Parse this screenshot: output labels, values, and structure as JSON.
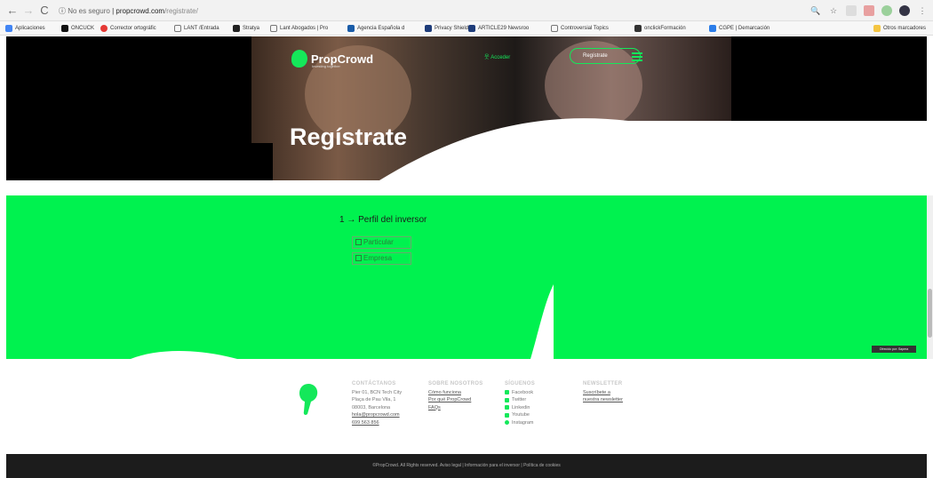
{
  "browser": {
    "secure_label": "No es seguro",
    "domain": "propcrowd.com",
    "path": "/registrate/",
    "bookmarks": [
      "Aplicaciones",
      "ONCUCK",
      "Corrector ortográfic",
      "LANT /Entrada",
      "Stratya",
      "Lant Abogados | Pro",
      "Agencia Española d",
      "Privacy Shield",
      "ARTICLE29 Newsroo",
      "Controversial Topics",
      "onclickFormación",
      "CGPE | Demarcación",
      "Otros marcadores"
    ]
  },
  "site": {
    "logo": "PropCrowd",
    "tagline": "Investing together",
    "acceder": "Acceder",
    "register": "Regístrate",
    "page_title": "Regístrate"
  },
  "form": {
    "perfil_label": "1 → Perfil del inversor",
    "options": [
      "Particular",
      "Empresa"
    ]
  },
  "footer": {
    "contact": {
      "title": "CONTÁCTANOS",
      "lines": [
        "Pier 01, BCN Tech City",
        "Plaça de Pau Vila, 1",
        "08003, Barcelona",
        "hola@propcrowd.com",
        "699 563 856"
      ]
    },
    "about": {
      "title": "SOBRE NOSOTROS",
      "links": [
        "Cómo funciona",
        "Por qué PropCrowd",
        "FAQs"
      ]
    },
    "social": {
      "title": "SÍGUENOS",
      "links": [
        "Facebook",
        "Twitter",
        "Linkedin",
        "Youtube",
        "Instagram"
      ]
    },
    "newsletter": {
      "title": "NEWSLETTER",
      "links": [
        "Suscríbete a",
        "nuestra newsletter"
      ]
    },
    "bottom": "©PropCrowd. All Rights reserved.   Aviso legal   |   Información para el inversor   |   Política de cookies"
  },
  "badge": "Ofrecido por: Sapera"
}
